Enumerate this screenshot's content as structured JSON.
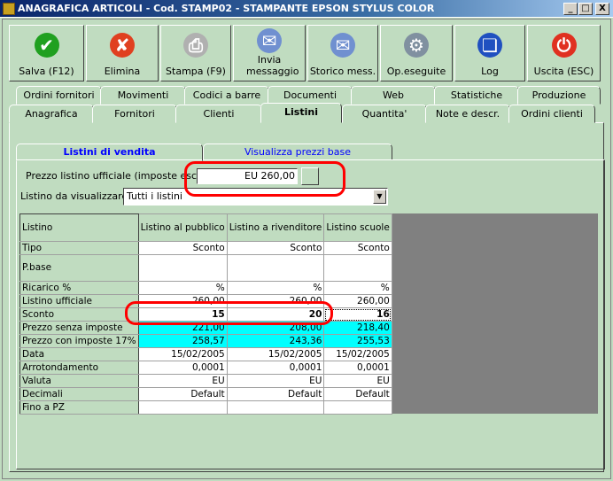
{
  "window": {
    "title": "ANAGRAFICA ARTICOLI - Cod. STAMP02 - STAMPANTE EPSON STYLUS COLOR",
    "min": "_",
    "max": "□",
    "close": "X"
  },
  "toolbar": [
    {
      "label": "Salva (F12)",
      "icon": "check-icon",
      "color": "#20a020",
      "glyph": "✔"
    },
    {
      "label": "Elimina",
      "icon": "x-icon",
      "color": "#e04020",
      "glyph": "✘"
    },
    {
      "label": "Stampa (F9)",
      "icon": "printer-icon",
      "color": "#b0b0b0",
      "glyph": "⎙"
    },
    {
      "label": "Invia messaggio",
      "icon": "envelope-pen-icon",
      "color": "#7090d0",
      "glyph": "✉"
    },
    {
      "label": "Storico mess.",
      "icon": "envelope-search-icon",
      "color": "#7090d0",
      "glyph": "✉"
    },
    {
      "label": "Op.eseguite",
      "icon": "gears-search-icon",
      "color": "#8090a0",
      "glyph": "⚙"
    },
    {
      "label": "Log",
      "icon": "book-search-icon",
      "color": "#2050c0",
      "glyph": "❏"
    },
    {
      "label": "Uscita (ESC)",
      "icon": "power-icon",
      "color": "#e03020",
      "glyph": "⏻"
    }
  ],
  "tabs_row1": [
    "Ordini fornitori",
    "Movimenti",
    "Codici a barre",
    "Documenti",
    "Web",
    "Statistiche",
    "Produzione"
  ],
  "tabs_row2": [
    "Anagrafica",
    "Fornitori",
    "Clienti",
    "Listini",
    "Quantita'",
    "Note e descr.",
    "Ordini clienti"
  ],
  "inner_tabs": [
    "Listini di vendita",
    "Visualizza prezzi base"
  ],
  "prezzo": {
    "label": "Prezzo listino ufficiale (imposte escluse) :",
    "value": "EU 260,00"
  },
  "listino_select": {
    "label": "Listino da visualizzare :",
    "value": "Tutti i listini"
  },
  "grid": {
    "header": [
      "Listino",
      "Listino al pubblico",
      "Listino a rivenditore",
      "Listino scuole"
    ],
    "rows": [
      {
        "label": "Tipo",
        "values": [
          "Sconto",
          "Sconto",
          "Sconto"
        ]
      },
      {
        "label": "P.base",
        "values": [
          "",
          "",
          ""
        ]
      },
      {
        "label": "Ricarico %",
        "values": [
          "%",
          "%",
          "%"
        ]
      },
      {
        "label": "Listino ufficiale",
        "values": [
          "260,00",
          "260,00",
          "260,00"
        ]
      },
      {
        "label": "Sconto",
        "values": [
          "15",
          "20",
          "16"
        ]
      },
      {
        "label": "Prezzo senza imposte",
        "values": [
          "221,00",
          "208,00",
          "218,40"
        ]
      },
      {
        "label": "Prezzo con imposte 17%",
        "values": [
          "258,57",
          "243,36",
          "255,53"
        ]
      },
      {
        "label": "Data",
        "values": [
          "15/02/2005",
          "15/02/2005",
          "15/02/2005"
        ]
      },
      {
        "label": "Arrotondamento",
        "values": [
          "0,0001",
          "0,0001",
          "0,0001"
        ]
      },
      {
        "label": "Valuta",
        "values": [
          "EU",
          "EU",
          "EU"
        ]
      },
      {
        "label": "Decimali",
        "values": [
          "Default",
          "Default",
          "Default"
        ]
      },
      {
        "label": "Fino a PZ",
        "values": [
          "",
          "",
          ""
        ]
      }
    ]
  }
}
